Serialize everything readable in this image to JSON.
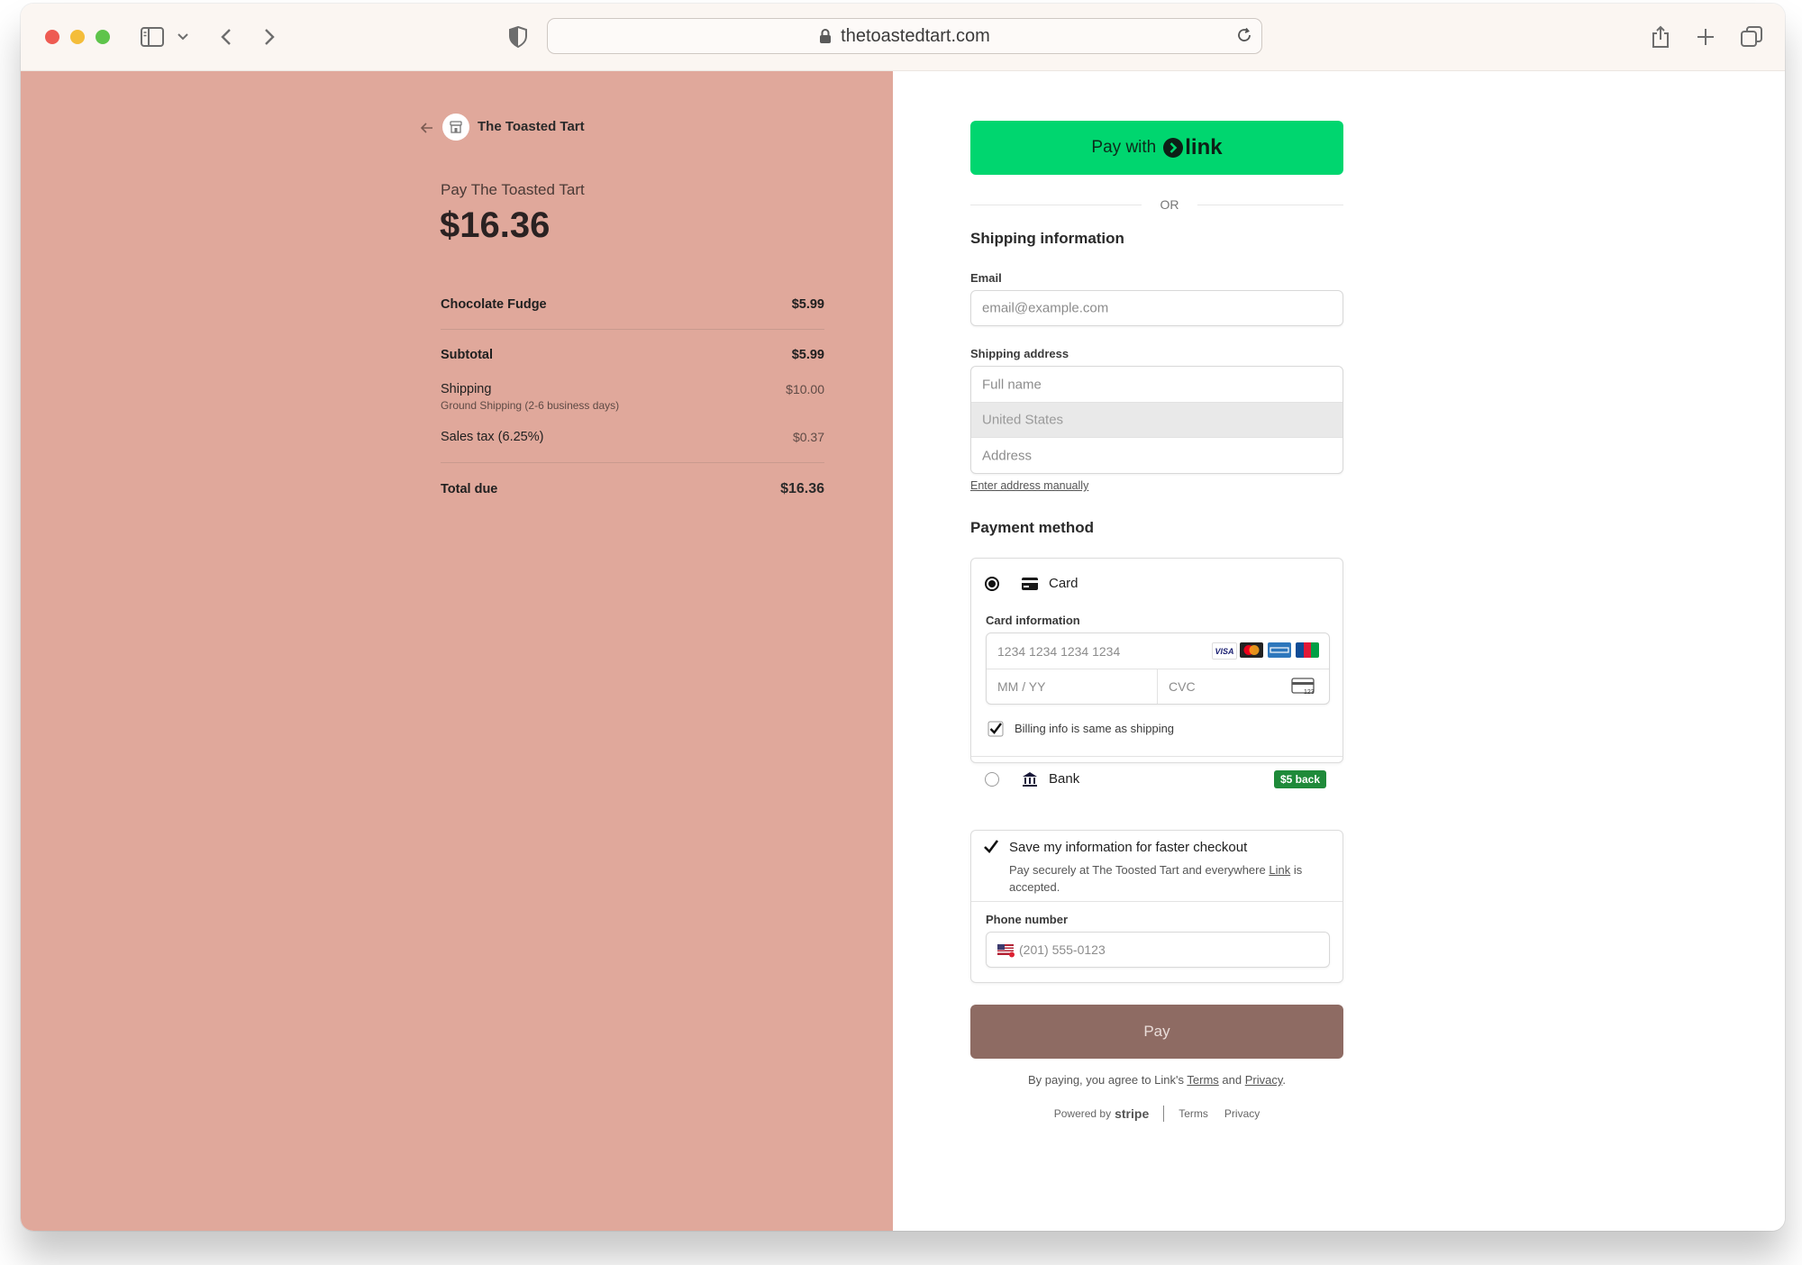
{
  "browser": {
    "url": "thetoastedtart.com",
    "icons": [
      "sidebar-icon",
      "chevron-down-icon",
      "back-icon",
      "forward-icon",
      "shield-icon",
      "lock-icon",
      "reload-icon",
      "share-icon",
      "plus-icon",
      "tabs-icon"
    ]
  },
  "merchant": {
    "name": "The Toasted Tart",
    "pay_label": "Pay The Toasted Tart",
    "amount": "$16.36"
  },
  "summary": {
    "item_name": "Chocolate Fudge",
    "item_price": "$5.99",
    "subtotal_label": "Subtotal",
    "subtotal_value": "$5.99",
    "shipping_label": "Shipping",
    "shipping_detail": "Ground Shipping (2-6 business days)",
    "shipping_value": "$10.00",
    "tax_label": "Sales tax (6.25%)",
    "tax_value": "$0.37",
    "total_label": "Total due",
    "total_value": "$16.36"
  },
  "link_button": {
    "prefix": "Pay with",
    "brand": "link"
  },
  "or_text": "OR",
  "shipping": {
    "heading": "Shipping information",
    "email_label": "Email",
    "email_placeholder": "email@example.com",
    "address_label": "Shipping address",
    "name_placeholder": "Full name",
    "country": "United States",
    "address_placeholder": "Address",
    "manual_link": "Enter address manually"
  },
  "payment": {
    "heading": "Payment method",
    "card_option": "Card",
    "card_info_label": "Card information",
    "card_number_placeholder": "1234 1234 1234 1234",
    "expiry_placeholder": "MM / YY",
    "cvc_placeholder": "CVC",
    "billing_same": "Billing info is same as shipping",
    "bank_option": "Bank",
    "bank_badge": "$5 back",
    "card_brands": {
      "visa": "VISA",
      "cvc_icon_text": "123"
    }
  },
  "save_info": {
    "title": "Save my information for faster checkout",
    "desc_before": "Pay securely at The Toosted Tart and everywhere",
    "desc_link": "Link",
    "desc_after": "is accepted.",
    "phone_label": "Phone number",
    "phone_placeholder": "(201) 555-0123"
  },
  "pay_button": "Pay",
  "legal": {
    "before": "By paying, you agree to Link's",
    "terms": "Terms",
    "and": "and",
    "privacy": "Privacy",
    "period": "."
  },
  "footer": {
    "powered_by": "Powered by",
    "stripe": "stripe",
    "terms": "Terms",
    "privacy": "Privacy"
  },
  "colors": {
    "left_panel": "#e0a89b",
    "link_green": "#00d66f",
    "pay_button": "#8e6b63",
    "bank_badge": "#1f8a3a"
  }
}
